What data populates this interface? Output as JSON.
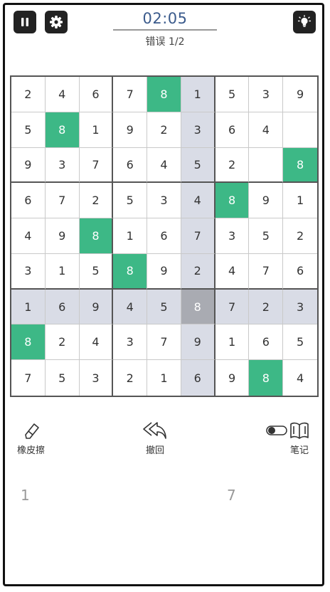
{
  "header": {
    "timer": "02:05",
    "mistakes": "错误 1/2"
  },
  "colors": {
    "accent_green": "#3db886",
    "highlight": "#d9dce6",
    "selected": "#a9abb2",
    "timer_text": "#3b5b8c"
  },
  "board": {
    "cells": [
      [
        "2",
        "4",
        "6",
        "7",
        "8",
        "1",
        "5",
        "3",
        "9"
      ],
      [
        "5",
        "8",
        "1",
        "9",
        "2",
        "3",
        "6",
        "4",
        ""
      ],
      [
        "9",
        "3",
        "7",
        "6",
        "4",
        "5",
        "2",
        "",
        "8"
      ],
      [
        "6",
        "7",
        "2",
        "5",
        "3",
        "4",
        "8",
        "9",
        "1"
      ],
      [
        "4",
        "9",
        "8",
        "1",
        "6",
        "7",
        "3",
        "5",
        "2"
      ],
      [
        "3",
        "1",
        "5",
        "8",
        "9",
        "2",
        "4",
        "7",
        "6"
      ],
      [
        "1",
        "6",
        "9",
        "4",
        "5",
        "8",
        "7",
        "2",
        "3"
      ],
      [
        "8",
        "2",
        "4",
        "3",
        "7",
        "9",
        "1",
        "6",
        "5"
      ],
      [
        "7",
        "5",
        "3",
        "2",
        "1",
        "6",
        "9",
        "8",
        "4"
      ]
    ],
    "selected": [
      6,
      5
    ],
    "green_cells": [
      [
        0,
        4
      ],
      [
        1,
        1
      ],
      [
        2,
        8
      ],
      [
        3,
        6
      ],
      [
        4,
        2
      ],
      [
        5,
        3
      ],
      [
        7,
        0
      ],
      [
        8,
        7
      ]
    ]
  },
  "tools": {
    "eraser_label": "橡皮擦",
    "undo_label": "撤回",
    "notes_label": "笔记",
    "notes_toggle": "off"
  },
  "numpad": {
    "remaining": [
      "1",
      "7"
    ]
  },
  "icons": {
    "pause": "pause-icon",
    "settings": "gear-icon",
    "hint": "lightbulb-icon",
    "eraser": "eraser-icon",
    "undo": "undo-icon",
    "notes": "book-icon"
  }
}
